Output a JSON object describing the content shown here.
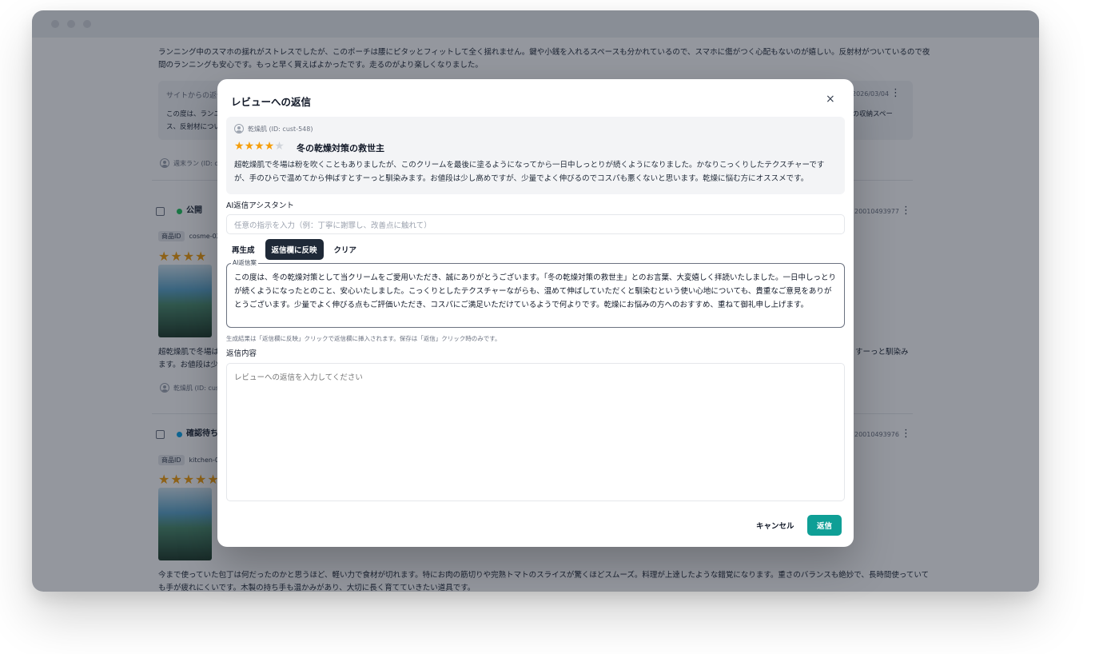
{
  "background": {
    "top_review_text_1": "ランニング中のスマホの揺れがストレスでしたが、このポーチは腰にピタッとフィットして全く揺れません。鍵や小銭を入れるスペースも分かれているので、スマホに傷がつく心配もないのが嬉しい。反射材がついているので夜",
    "top_review_text_2": "間のランニングも安心です。もっと早く買えばよかったです。走るのがより楽しくなりました。",
    "site_reply_label": "サイトからの返信",
    "site_reply_date": "2026/03/04",
    "site_reply_text_1": "この度は、ランニ",
    "site_reply_text_1_end": "品の収納スペー",
    "site_reply_text_2": "ス、反射材につい",
    "top_reviewer": "週末ラン (ID: cust",
    "card1": {
      "status": "公開",
      "status_color": "#22c55e",
      "order_id": "20010493977",
      "product_tag": "商品ID",
      "product_code": "cosme-02",
      "text_1": "超乾燥肌で冬場は",
      "text_1_end": "すーっと馴染み",
      "text_2": "ます。お値段は少",
      "reviewer": "乾燥肌 (ID: cust"
    },
    "card2": {
      "status": "確認待ち",
      "status_color": "#0ea5e9",
      "order_id": "20010493976",
      "product_tag": "商品ID",
      "product_code": "kitchen-0",
      "text_1": "今まで使っていた包丁は何だったのかと思うほど、軽い力で食材が切れます。特にお肉の筋切りや完熟トマトのスライスが驚くほどスムーズ。料理が上達したような錯覚になります。重さのバランスも絶妙で、長時間使っていて",
      "text_2": "も手が疲れにくいです。木製の持ち手も温かみがあり、大切に長く育てていきたい道具です。"
    }
  },
  "modal": {
    "title": "レビューへの返信",
    "close_icon": "×",
    "review": {
      "user": "乾燥肌 (ID: cust-548)",
      "rating": 4,
      "rating_max": 5,
      "title": "冬の乾燥対策の救世主",
      "body": "超乾燥肌で冬場は粉を吹くこともありましたが、このクリームを最後に塗るようになってから一日中しっとりが続くようになりました。かなりこっくりしたテクスチャーですが、手のひらで温めてから伸ばすとすーっと馴染みます。お値段は少し高めですが、少量でよく伸びるのでコスパも悪くないと思います。乾燥に悩む方にオススメです。"
    },
    "ai_assistant_label": "AI返信アシスタント",
    "instruction_placeholder": "任意の指示を入力（例：丁寧に謝罪し、改善点に触れて）",
    "buttons": {
      "regenerate": "再生成",
      "apply": "返信欄に反映",
      "clear": "クリア"
    },
    "ai_draft_label": "AI返信案",
    "ai_draft_text": "この度は、冬の乾燥対策として当クリームをご愛用いただき、誠にありがとうございます。「冬の乾燥対策の救世主」とのお言葉、大変嬉しく拝読いたしました。一日中しっとりが続くようになったとのこと、安心いたしました。こっくりとしたテクスチャーながらも、温めて伸ばしていただくと馴染むという使い心地についても、貴重なご意見をありがとうございます。少量でよく伸びる点もご評価いただき、コスパにご満足いただけているようで何よりです。乾燥にお悩みの方へのおすすめ、重ねて御礼申し上げます。",
    "hint": "生成結果は「返信欄に反映」クリックで返信欄に挿入されます。保存は「返信」クリック時のみです。",
    "reply_label": "返信内容",
    "reply_placeholder": "レビューへの返信を入力してください",
    "cancel": "キャンセル",
    "send": "返信"
  }
}
